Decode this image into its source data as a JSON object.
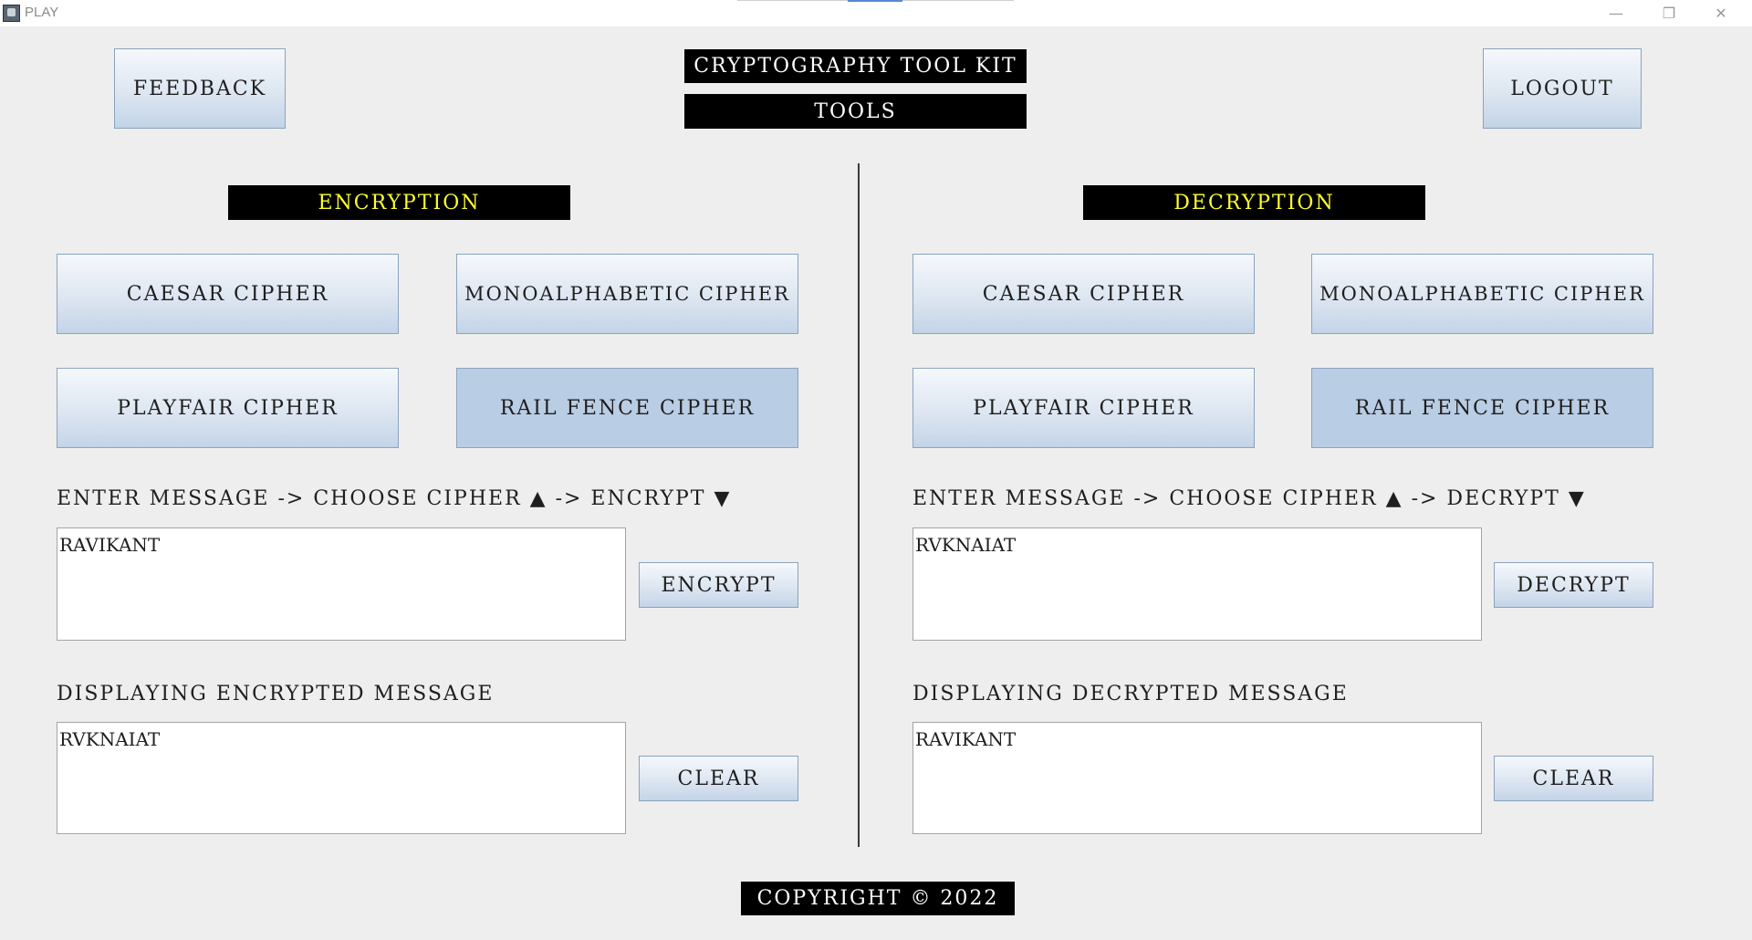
{
  "window": {
    "title": "PLAY",
    "minimize_glyph": "—",
    "maximize_glyph": "❐",
    "close_glyph": "✕"
  },
  "header": {
    "feedback_label": "FEEDBACK",
    "app_title": "CRYPTOGRAPHY TOOL KIT",
    "subtitle": "TOOLS",
    "logout_label": "LOGOUT"
  },
  "encryption": {
    "heading": "ENCRYPTION",
    "ciphers": {
      "caesar": "CAESAR CIPHER",
      "mono": "MONOALPHABETIC CIPHER",
      "playfair": "PLAYFAIR CIPHER",
      "railfence": "RAIL FENCE CIPHER"
    },
    "selected_cipher": "RAIL FENCE CIPHER",
    "instruction": "ENTER MESSAGE -> CHOOSE CIPHER ▲ -> ENCRYPT ▼",
    "input_value": "RAVIKANT",
    "action_label": "ENCRYPT",
    "output_heading": "DISPLAYING ENCRYPTED MESSAGE",
    "output_value": "RVKNAIAT",
    "clear_label": "CLEAR"
  },
  "decryption": {
    "heading": "DECRYPTION",
    "ciphers": {
      "caesar": "CAESAR CIPHER",
      "mono": "MONOALPHABETIC CIPHER",
      "playfair": "PLAYFAIR CIPHER",
      "railfence": "RAIL FENCE CIPHER"
    },
    "selected_cipher": "RAIL FENCE CIPHER",
    "instruction": "ENTER MESSAGE -> CHOOSE CIPHER ▲ -> DECRYPT ▼",
    "input_value": "RVKNAIAT",
    "action_label": "DECRYPT",
    "output_heading": "DISPLAYING DECRYPTED MESSAGE",
    "output_value": "RAVIKANT",
    "clear_label": "CLEAR"
  },
  "footer": {
    "copyright": "COPYRIGHT © 2022"
  },
  "colors": {
    "background": "#eeeeee",
    "heading_text": "#ffff2e",
    "banner_bg": "#000000",
    "button_border": "#8ba3bf",
    "selected_button": "#b9cde4"
  }
}
